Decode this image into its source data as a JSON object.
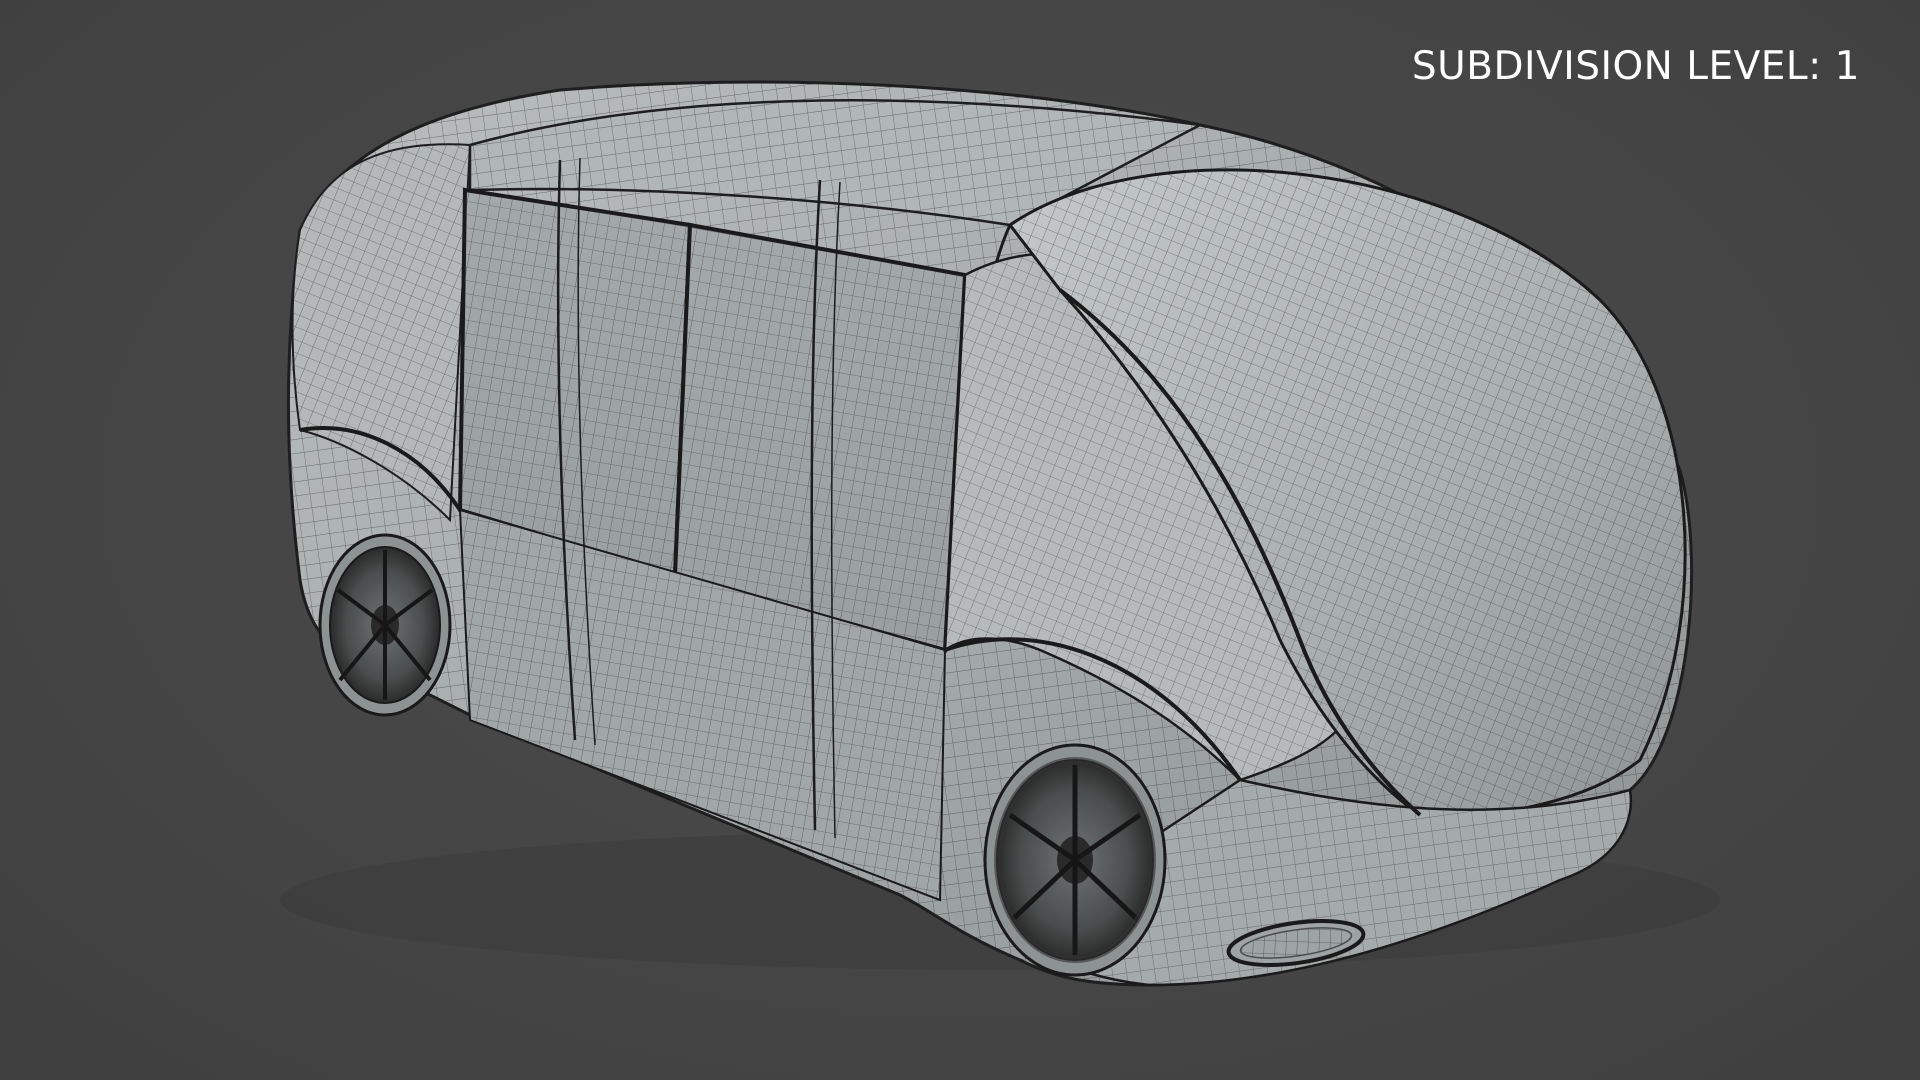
{
  "overlay": {
    "subdivision_label": "SUBDIVISION LEVEL: 1"
  },
  "colors": {
    "background": "#474747",
    "body_shade": "#a8adad",
    "wire": "#2a2a2a",
    "label_text": "#ffffff"
  },
  "scene": {
    "object": "vehicle-pod-wireframe",
    "view": "three-quarter-rear",
    "wheels_visible": 2
  }
}
